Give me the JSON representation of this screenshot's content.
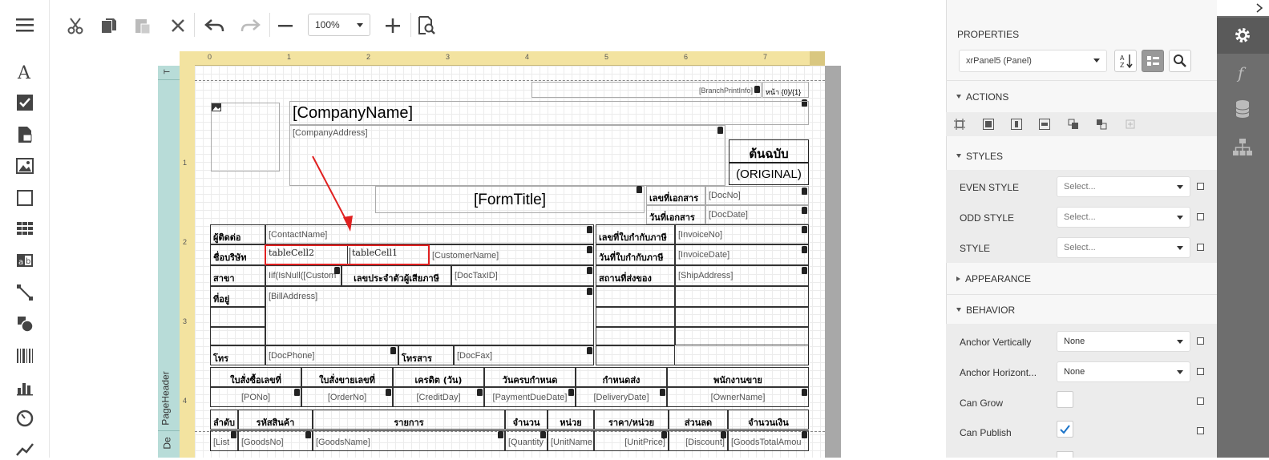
{
  "toolbar": {
    "zoom": "100%"
  },
  "ruler": {
    "h_ticks": [
      "0",
      "1",
      "2",
      "3",
      "4",
      "5",
      "6",
      "7"
    ],
    "v_ticks": [
      "1",
      "2",
      "3",
      "4"
    ],
    "band_top": "T",
    "band_pageheader": "PageHeader",
    "band_detail": "De"
  },
  "report": {
    "branch_print": "[BranchPrintInfo]",
    "page_num": "หน้า {0}/{1}",
    "company_name": "[CompanyName]",
    "company_address": "[CompanyAddress]",
    "original_th": "ต้นฉบับ",
    "original_en": "(ORIGINAL)",
    "form_title": "[FormTitle]",
    "doc_no_label": "เลขที่เอกสาร",
    "doc_no": "[DocNo]",
    "doc_date_label": "วันที่เอกสาร",
    "doc_date": "[DocDate]",
    "contact_label": "ผู้ติดต่อ",
    "contact": "[ContactName]",
    "invoice_no_label": "เลขที่ใบกำกับภาษี",
    "invoice_no": "[InvoiceNo]",
    "company_label": "ชื่อบริษัท",
    "table_cell2": "tableCell2",
    "table_cell1": "tableCell1",
    "customer_name": "[CustomerName]",
    "invoice_date_label": "วันที่ใบกำกับภาษี",
    "invoice_date": "[InvoiceDate]",
    "branch_label": "สาขา",
    "branch_expr": "Iif(IsNull([Custom",
    "tax_id_label": "เลขประจำตัวผู้เสียภาษี",
    "tax_id": "[DocTaxID]",
    "ship_label": "สถานที่ส่งของ",
    "ship_address": "[ShipAddress]",
    "address_label": "ที่อยู่",
    "bill_address": "[BillAddress]",
    "phone_label": "โทร",
    "phone": "[DocPhone]",
    "fax_label": "โทรสาร",
    "fax": "[DocFax]",
    "order_headers": [
      "ใบสั่งซื้อเลขที่",
      "ใบสั่งขายเลขที่",
      "เครดิต (วัน)",
      "วันครบกำหนด",
      "กำหนดส่ง",
      "พนักงานขาย"
    ],
    "order_values": [
      "[PONo]",
      "[OrderNo]",
      "[CreditDay]",
      "[PaymentDueDate]",
      "[DeliveryDate]",
      "[OwnerName]"
    ],
    "item_headers": [
      "ลำดับ",
      "รหัสสินค้า",
      "รายการ",
      "จำนวน",
      "หน่วย",
      "ราคา/หน่วย",
      "ส่วนลด",
      "จำนวนเงิน"
    ],
    "item_values": [
      "[List",
      "[GoodsNo]",
      "[GoodsName]",
      "[Quantity",
      "[UnitName",
      "[UnitPrice]",
      "[Discount]",
      "[GoodsTotalAmou"
    ]
  },
  "properties": {
    "title": "PROPERTIES",
    "component": "xrPanel5 (Panel)",
    "actions": "ACTIONS",
    "styles": "STYLES",
    "even_style": "EVEN STYLE",
    "odd_style": "ODD STYLE",
    "style": "STYLE",
    "select_placeholder": "Select...",
    "appearance": "APPEARANCE",
    "behavior": "BEHAVIOR",
    "anchor_v_label": "Anchor Vertically",
    "anchor_v": "None",
    "anchor_h_label": "Anchor Horizont...",
    "anchor_h": "None",
    "can_grow_label": "Can Grow",
    "can_publish_label": "Can Publish",
    "can_grow": false,
    "can_publish": true
  },
  "colors": {
    "accent_red": "#e02020",
    "ruler": "#f3e3a0",
    "band": "#b8dcd8",
    "sidenav": "#6e6e6e",
    "link_blue": "#1a73c8"
  }
}
